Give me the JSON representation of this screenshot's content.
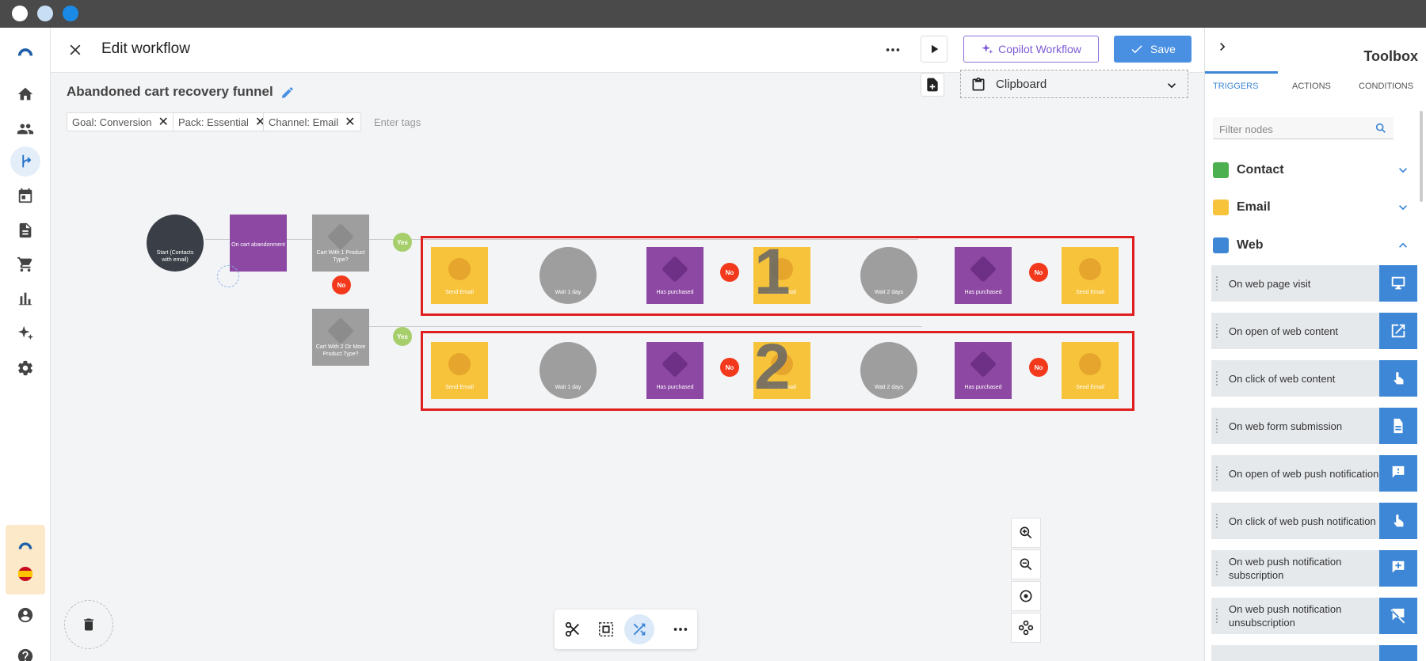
{
  "colors": {
    "accent": "#3d87d6",
    "save": "#4a90e2",
    "copilot": "#7d5bd6",
    "red": "#e01e1e",
    "email": "#f7c33a",
    "purchase": "#8d48a3",
    "wait": "#9e9e9e"
  },
  "header": {
    "title": "Edit workflow",
    "copilot_label": "Copilot Workflow",
    "save_label": "Save"
  },
  "workflow": {
    "name": "Abandoned cart recovery funnel",
    "tags": [
      "Goal: Conversion",
      "Pack: Essential",
      "Channel: Email"
    ],
    "tags_placeholder": "Enter tags",
    "clipboard_label": "Clipboard"
  },
  "nodes": {
    "start": "Start (Contacts with email)",
    "cart_abandon": "On cart abandonment",
    "cond1": "Cart With 1 Product Type?",
    "cond2": "Cart With 2 Or More Product Type?",
    "send_email": "Send Email",
    "wait1": "Wait 1 day",
    "wait2": "Wait 2 days",
    "has_purchased": "Has purchased",
    "yes": "Yes",
    "no": "No",
    "box1": "1",
    "box2": "2"
  },
  "toolbox": {
    "title": "Toolbox",
    "tabs": [
      "TRIGGERS",
      "ACTIONS",
      "CONDITIONS"
    ],
    "filter_placeholder": "Filter nodes",
    "sections": [
      "Contact",
      "Email",
      "Web"
    ],
    "items": [
      "On web page visit",
      "On open of web content",
      "On click of web content",
      "On web form submission",
      "On open of web push notification",
      "On click of web push notification",
      "On web push notification subscription",
      "On web push notification unsubscription"
    ]
  },
  "icons": [
    "close-icon",
    "more-icon",
    "play-icon",
    "sparkle-icon",
    "check-icon",
    "pencil-icon",
    "add-note-icon",
    "clipboard-icon",
    "chevron-down-icon",
    "zoom-in-icon",
    "zoom-out-icon",
    "target-icon",
    "nodes-icon",
    "scissors-icon",
    "select-icon",
    "shuffle-icon",
    "trash-icon",
    "search-icon"
  ]
}
